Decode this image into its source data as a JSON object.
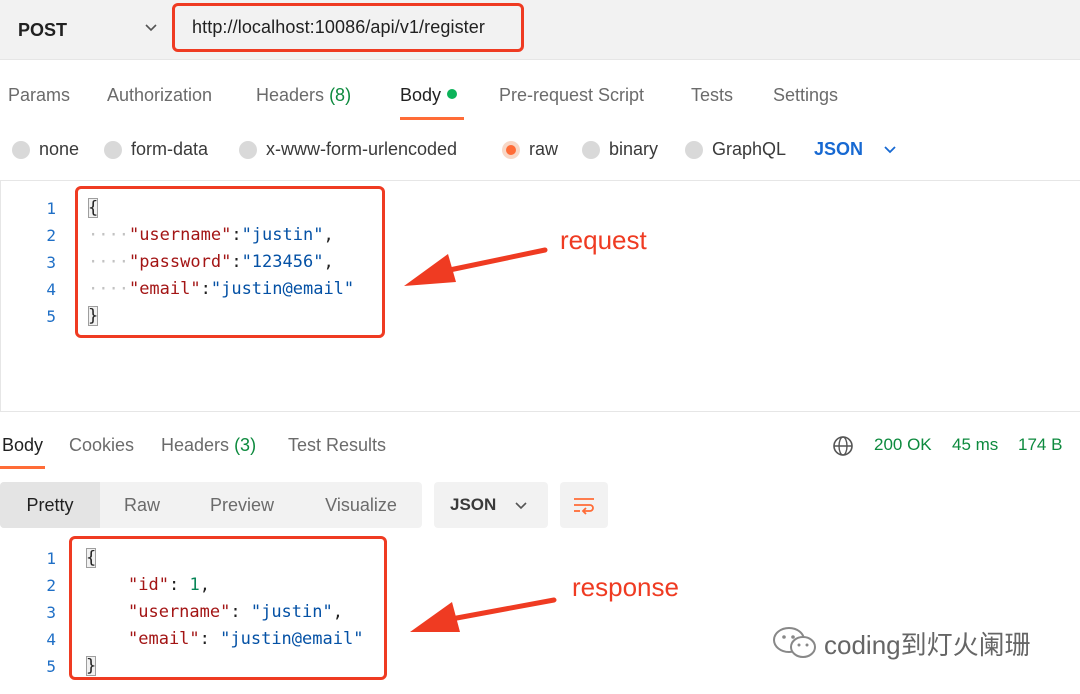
{
  "request": {
    "method": "POST",
    "url": "http://localhost:10086/api/v1/register"
  },
  "request_tabs": [
    {
      "label": "Params"
    },
    {
      "label": "Authorization"
    },
    {
      "label": "Headers",
      "count": "(8)"
    },
    {
      "label": "Body",
      "active": true
    },
    {
      "label": "Pre-request Script"
    },
    {
      "label": "Tests"
    },
    {
      "label": "Settings"
    }
  ],
  "body_types": [
    {
      "label": "none"
    },
    {
      "label": "form-data"
    },
    {
      "label": "x-www-form-urlencoded"
    },
    {
      "label": "raw",
      "selected": true
    },
    {
      "label": "binary"
    },
    {
      "label": "GraphQL"
    }
  ],
  "raw_format": "JSON",
  "request_body": {
    "line_numbers": [
      "1",
      "2",
      "3",
      "4",
      "5"
    ],
    "lines": [
      "{",
      "\"username\":\"justin\",",
      "\"password\":\"123456\",",
      "\"email\":\"justin@email\"",
      "}"
    ],
    "tokens": {
      "open": "{",
      "close": "}",
      "dots": "····",
      "k_username": "\"username\"",
      "v_username": "\"justin\"",
      "k_password": "\"password\"",
      "v_password": "\"123456\"",
      "k_email": "\"email\"",
      "v_email": "\"justin@email\"",
      "colon": ":",
      "comma": ","
    }
  },
  "response_tabs": [
    {
      "label": "Body",
      "active": true
    },
    {
      "label": "Cookies"
    },
    {
      "label": "Headers",
      "count": "(3)"
    },
    {
      "label": "Test Results"
    }
  ],
  "response_status": {
    "status": "200 OK",
    "time": "45 ms",
    "size": "174 B"
  },
  "view_modes": [
    "Pretty",
    "Raw",
    "Preview",
    "Visualize"
  ],
  "response_format": "JSON",
  "response_body": {
    "line_numbers": [
      "1",
      "2",
      "3",
      "4",
      "5"
    ],
    "lines": [
      "{",
      "\"id\": 1,",
      "\"username\": \"justin\",",
      "\"email\": \"justin@email\"",
      "}"
    ],
    "tokens": {
      "open": "{",
      "close": "}",
      "k_id": "\"id\"",
      "v_id": "1",
      "k_username": "\"username\"",
      "v_username": "\"justin\"",
      "k_email": "\"email\"",
      "v_email": "\"justin@email\"",
      "colon_sp": ": ",
      "comma": ","
    }
  },
  "annotations": {
    "request_label": "request",
    "response_label": "response"
  },
  "watermark": "coding到灯火阑珊",
  "icons": [
    "chevron-down-icon",
    "globe-icon",
    "wrap-lines-icon",
    "wechat-icon",
    "arrow-icon"
  ],
  "colors": {
    "accent": "#ff6c37",
    "annotation_red": "#ef3b22",
    "status_green": "#0d8a3e",
    "link_blue": "#1769d2"
  }
}
